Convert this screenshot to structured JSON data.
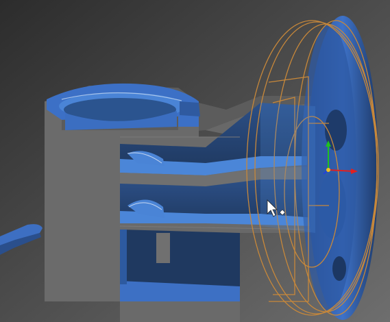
{
  "viewport": {
    "kind": "3d-cad-viewport",
    "background_colors": [
      "#2e2e2e",
      "#6a6a6a"
    ]
  },
  "model": {
    "cut_face_color": "#6d6d6d",
    "inner_surface_color": "#3f72c4",
    "highlight_surface_color": "#4b86d8",
    "selection_outline_color": "#c8883a"
  },
  "triad": {
    "axes": [
      "x",
      "y",
      "z"
    ],
    "colors": {
      "x": "#e02020",
      "y": "#20c020",
      "z": "#2040e0"
    }
  },
  "cursor": {
    "icon": "move-arrow-cursor-icon",
    "color": "#ffffff"
  }
}
